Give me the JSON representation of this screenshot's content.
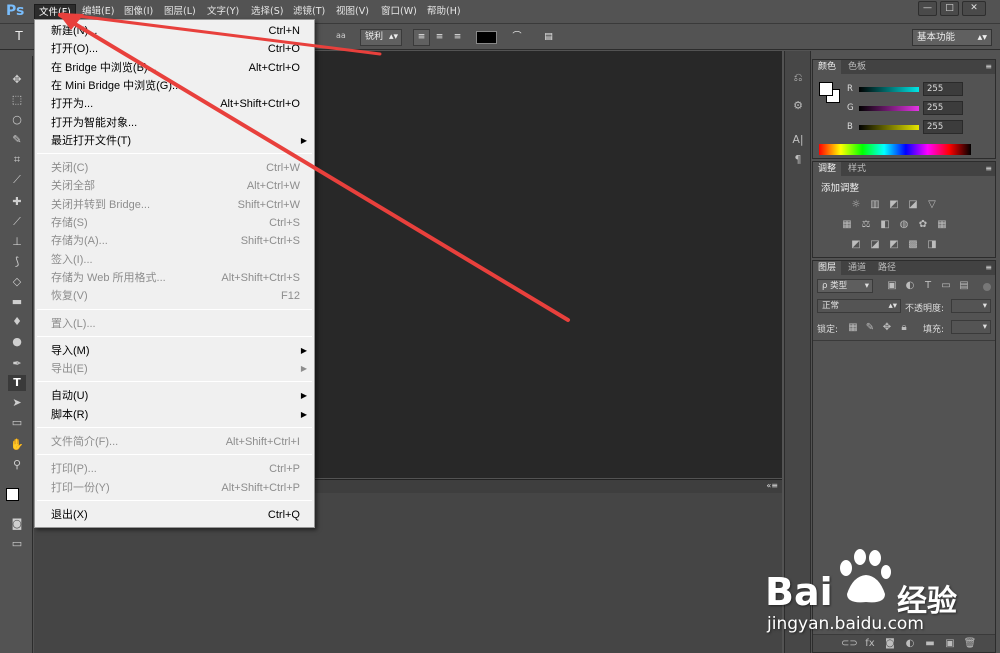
{
  "app": {
    "logo": "Ps"
  },
  "menubar": {
    "items": [
      "文件(F)",
      "编辑(E)",
      "图像(I)",
      "图层(L)",
      "文字(Y)",
      "选择(S)",
      "滤镜(T)",
      "视图(V)",
      "窗口(W)",
      "帮助(H)"
    ],
    "active_index": 0
  },
  "window_controls": {
    "minimize": "—",
    "maximize": "□",
    "close": "✕"
  },
  "options_bar": {
    "aa_icon": "aa",
    "aa_value": "锐利",
    "workspace": "基本功能",
    "text_color": "#000000"
  },
  "file_menu": {
    "items": [
      {
        "label": "新建(N)...",
        "shortcut": "Ctrl+N",
        "disabled": false
      },
      {
        "label": "打开(O)...",
        "shortcut": "Ctrl+O",
        "disabled": false
      },
      {
        "label": "在 Bridge 中浏览(B)...",
        "shortcut": "Alt+Ctrl+O",
        "disabled": false
      },
      {
        "label": "在 Mini Bridge 中浏览(G)...",
        "shortcut": "",
        "disabled": false
      },
      {
        "label": "打开为...",
        "shortcut": "Alt+Shift+Ctrl+O",
        "disabled": false
      },
      {
        "label": "打开为智能对象...",
        "shortcut": "",
        "disabled": false
      },
      {
        "label": "最近打开文件(T)",
        "shortcut": "",
        "disabled": false,
        "submenu": true
      },
      {
        "label": "关闭(C)",
        "shortcut": "Ctrl+W",
        "disabled": true
      },
      {
        "label": "关闭全部",
        "shortcut": "Alt+Ctrl+W",
        "disabled": true
      },
      {
        "label": "关闭并转到 Bridge...",
        "shortcut": "Shift+Ctrl+W",
        "disabled": true
      },
      {
        "label": "存储(S)",
        "shortcut": "Ctrl+S",
        "disabled": true
      },
      {
        "label": "存储为(A)...",
        "shortcut": "Shift+Ctrl+S",
        "disabled": true
      },
      {
        "label": "签入(I)...",
        "shortcut": "",
        "disabled": true
      },
      {
        "label": "存储为 Web 所用格式...",
        "shortcut": "Alt+Shift+Ctrl+S",
        "disabled": true
      },
      {
        "label": "恢复(V)",
        "shortcut": "F12",
        "disabled": true
      },
      {
        "label": "置入(L)...",
        "shortcut": "",
        "disabled": true
      },
      {
        "label": "导入(M)",
        "shortcut": "",
        "disabled": false,
        "submenu": true
      },
      {
        "label": "导出(E)",
        "shortcut": "",
        "disabled": true,
        "submenu": true
      },
      {
        "label": "自动(U)",
        "shortcut": "",
        "disabled": false,
        "submenu": true
      },
      {
        "label": "脚本(R)",
        "shortcut": "",
        "disabled": false,
        "submenu": true
      },
      {
        "label": "文件简介(F)...",
        "shortcut": "Alt+Shift+Ctrl+I",
        "disabled": true
      },
      {
        "label": "打印(P)...",
        "shortcut": "Ctrl+P",
        "disabled": true
      },
      {
        "label": "打印一份(Y)",
        "shortcut": "Alt+Shift+Ctrl+P",
        "disabled": true
      },
      {
        "label": "退出(X)",
        "shortcut": "Ctrl+Q",
        "disabled": false
      }
    ]
  },
  "color_panel": {
    "tabs": [
      "颜色",
      "色板"
    ],
    "sliders": [
      {
        "channel": "R",
        "value": "255",
        "color": "#00e5e5"
      },
      {
        "channel": "G",
        "value": "255",
        "color": "#e535e5"
      },
      {
        "channel": "B",
        "value": "255",
        "color": "#e5e500"
      }
    ]
  },
  "adjustments_panel": {
    "tabs": [
      "调整",
      "样式"
    ],
    "heading": "添加调整"
  },
  "layers_panel": {
    "tabs": [
      "图层",
      "通道",
      "路径"
    ],
    "filter_label": "ρ 类型",
    "blend_mode": "正常",
    "opacity_label": "不透明度:",
    "lock_label": "锁定:",
    "fill_label": "填充:"
  },
  "annotation": {
    "arrow_color": "#e8403c"
  },
  "watermark": {
    "brand": "Bai",
    "brand_cn": "经验",
    "url": "jingyan.baidu.com"
  }
}
